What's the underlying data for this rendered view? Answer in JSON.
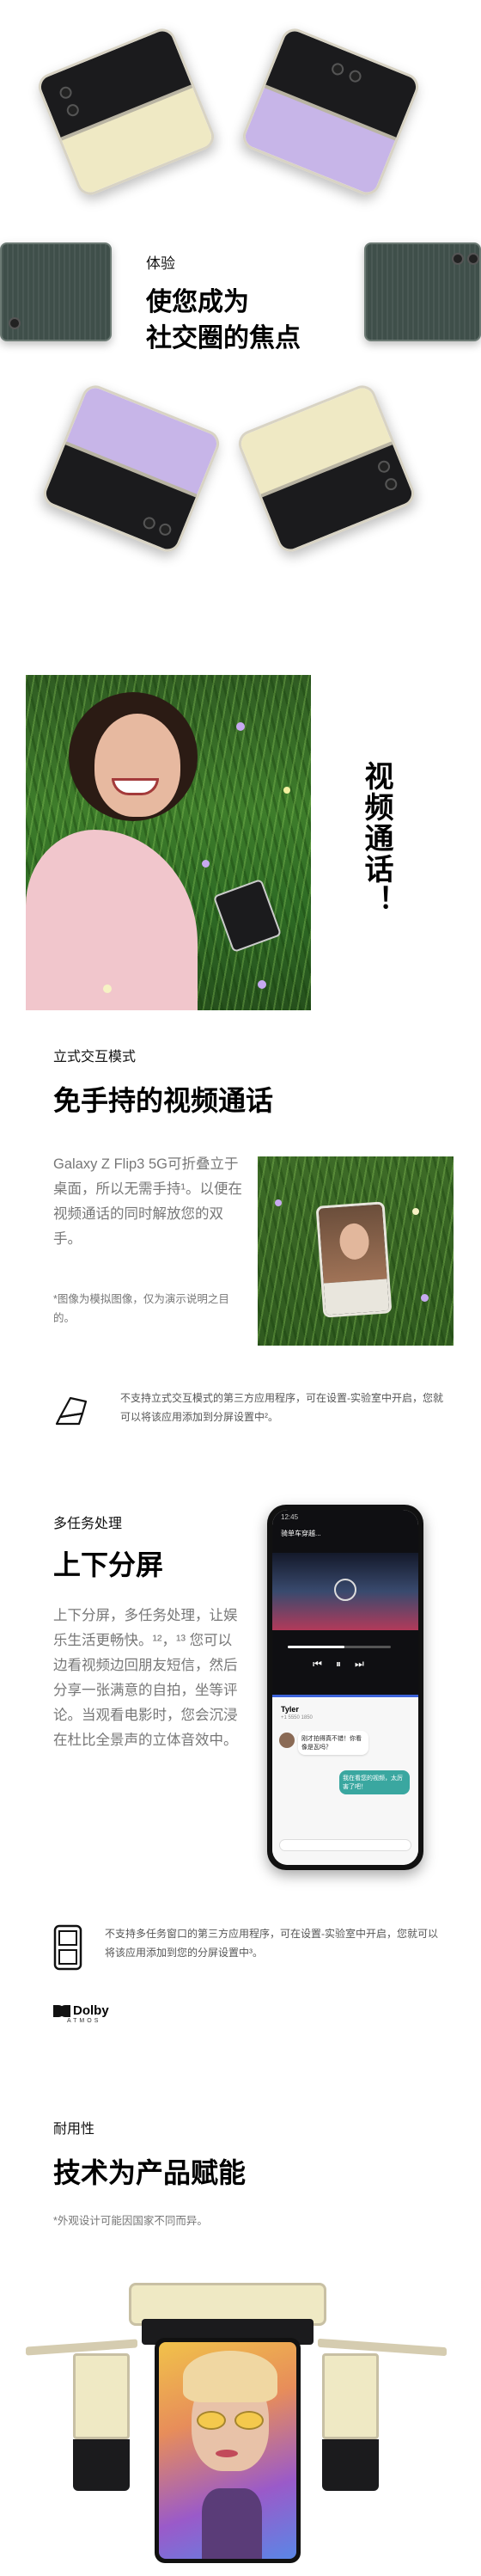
{
  "experience": {
    "label": "体验",
    "title_line1": "使您成为",
    "title_line2": "社交圈的焦点"
  },
  "video_call": {
    "vertical_title": "视频通话！",
    "label": "立式交互模式",
    "title": "免手持的视频通话",
    "body": "Galaxy Z Flip3 5G可折叠立于桌面，所以无需手持¹。以便在视频通话的同时解放您的双手。",
    "disclaimer": "*图像为模拟图像，仅为演示说明之目的。",
    "support_note": "不支持立式交互模式的第三方应用程序，可在设置-实验室中开启，您就可以将该应用添加到分屏设置中²。"
  },
  "multitask": {
    "label": "多任务处理",
    "title": "上下分屏",
    "body": "上下分屏，多任务处理，让娱乐生活更畅快。¹²，¹³ 您可以边看视频边回朋友短信，然后分享一张满意的自拍，坐等评论。当观看电影时，您会沉浸在杜比全景声的立体音效中。",
    "support_note": "不支持多任务窗口的第三方应用程序，可在设置-实验室中开启，您就可以将该应用添加到您的分屏设置中³。",
    "dolby": "Dolby",
    "atmos": "ATMOS",
    "phone": {
      "time": "12:45",
      "video_title": "骑单车穿越...",
      "chat_name": "Tyler",
      "chat_sub": "+1 5550 1850",
      "msg_in": "刚才拍得真不错！你看像是瓦吗？",
      "msg_out": "我在看您的视频，太厉害了吧！"
    }
  },
  "durability": {
    "label": "耐用性",
    "title": "技术为产品赋能",
    "note": "*外观设计可能因国家不同而异。"
  },
  "colors": {
    "cream": "#efe9c4",
    "lavender": "#c7b5e8",
    "green": "#3f4f4a",
    "black": "#1b1b1d",
    "chat_bubble": "#3aa7a0"
  }
}
